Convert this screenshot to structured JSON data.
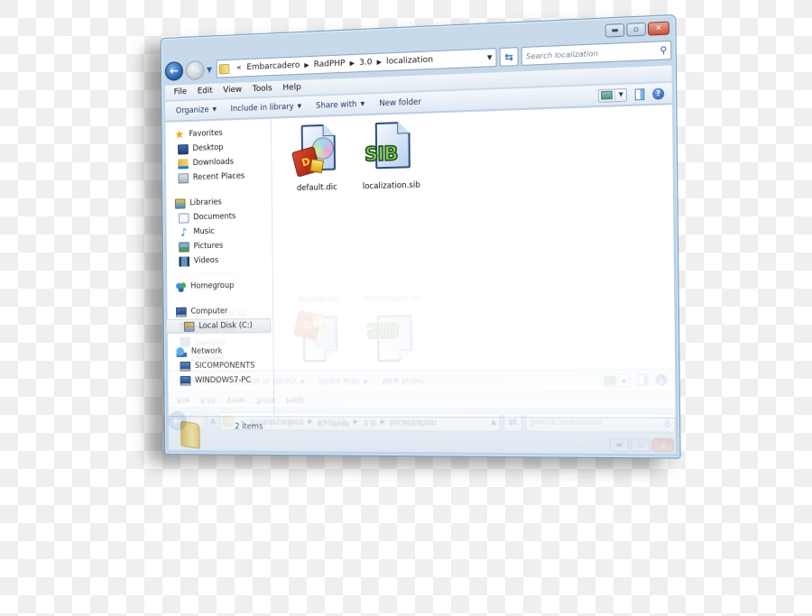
{
  "window": {
    "caption_buttons": {
      "minimize": "minimize-icon",
      "maximize": "maximize-icon",
      "close": "close-icon"
    }
  },
  "navigation": {
    "back_icon": "arrow-left-icon",
    "forward_icon": "arrow-right-icon",
    "breadcrumb_overflow": "«",
    "breadcrumb": [
      "Embarcadero",
      "RadPHP",
      "3.0",
      "localization"
    ],
    "refresh_icon": "refresh-icon",
    "search_placeholder": "Search localization"
  },
  "menu": [
    "File",
    "Edit",
    "View",
    "Tools",
    "Help"
  ],
  "commands": [
    {
      "label": "Organize",
      "dropdown": true
    },
    {
      "label": "Include in library",
      "dropdown": true
    },
    {
      "label": "Share with",
      "dropdown": true
    },
    {
      "label": "New folder",
      "dropdown": false
    }
  ],
  "nav_pane": {
    "favorites": {
      "label": "Favorites",
      "items": [
        "Desktop",
        "Downloads",
        "Recent Places"
      ]
    },
    "libraries": {
      "label": "Libraries",
      "items": [
        "Documents",
        "Music",
        "Pictures",
        "Videos"
      ]
    },
    "homegroup": {
      "label": "Homegroup"
    },
    "computer": {
      "label": "Computer",
      "items": [
        "Local Disk (C:)"
      ],
      "selected": "Local Disk (C:)"
    },
    "network": {
      "label": "Network",
      "items": [
        "SICOMPONENTS",
        "WINDOWS7-PC"
      ]
    }
  },
  "files": [
    {
      "name": "default.dic",
      "icon": "dictionary-file-icon"
    },
    {
      "name": "localization.sib",
      "icon": "sib-file-icon",
      "badge": "SIB"
    }
  ],
  "status": {
    "item_count": "2 items"
  },
  "colors": {
    "frame": "#b9cfe4",
    "close_button": "#c8533d",
    "link_text": "#1e395b"
  }
}
